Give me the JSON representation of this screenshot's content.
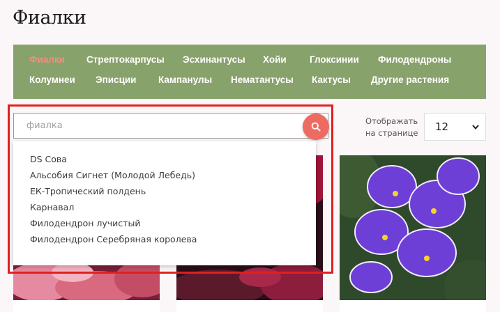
{
  "page": {
    "title": "Фиалки"
  },
  "nav": {
    "row1": [
      {
        "label": "Фиалки",
        "active": true
      },
      {
        "label": "Стрептокарпусы",
        "active": false
      },
      {
        "label": "Эсхинантусы",
        "active": false
      },
      {
        "label": "Хойи",
        "active": false
      },
      {
        "label": "Глоксинии",
        "active": false
      },
      {
        "label": "Филодендроны",
        "active": false
      }
    ],
    "row2": [
      {
        "label": "Колумнеи",
        "active": false
      },
      {
        "label": "Эписции",
        "active": false
      },
      {
        "label": "Кампанулы",
        "active": false
      },
      {
        "label": "Нематантусы",
        "active": false
      },
      {
        "label": "Кактусы",
        "active": false
      },
      {
        "label": "Другие растения",
        "active": false
      }
    ],
    "active_color": "#ee8f82",
    "bar_color": "#88a26c"
  },
  "search": {
    "value": "",
    "placeholder": "фиалка",
    "button_icon": "search-icon",
    "button_color": "#ee6b62",
    "suggestions": [
      "DS Сова",
      "Альсобия Сигнет (Молодой Лебедь)",
      "ЕК-Тропический полдень",
      "Карнавал",
      "Филодендрон лучистый",
      "Филодендрон Серебряная королева"
    ]
  },
  "per_page": {
    "label_line1": "Отображать",
    "label_line2": "на странице",
    "selected": "12"
  },
  "highlight_color": "#e02020"
}
